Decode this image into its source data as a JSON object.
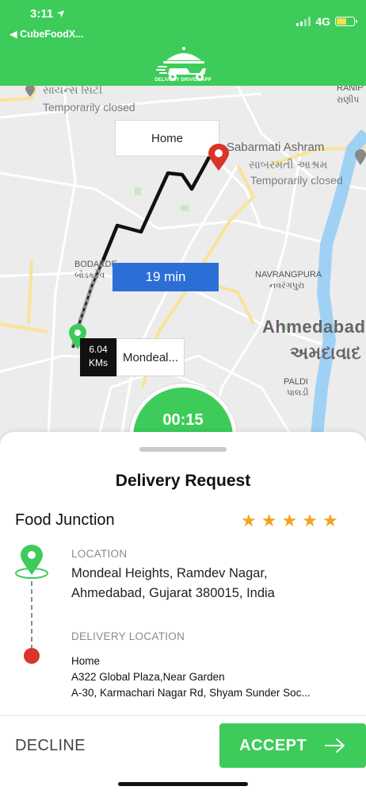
{
  "status_bar": {
    "time": "3:11",
    "back_app": "CubeFoodX...",
    "network": "4G"
  },
  "header": {
    "logo_caption": "DELIVERY DRIVER APP",
    "background_color": "#3dcc5a"
  },
  "map": {
    "labels": {
      "top_left_place": "સાયન્સ સિટી",
      "top_left_status": "Temporarily closed",
      "ashram_en": "Sabarmati Ashram",
      "ashram_gu": "સાબરમતી આશ્રમ",
      "ashram_status": "Temporarily closed",
      "ranip_en": "RANIP",
      "ranip_gu": "રાણીપ",
      "bodakdev_en": "BODAKDE",
      "bodakdev_gu": "બોડકદેવ",
      "navrangpura_en": "NAVRANGPURA",
      "navrangpura_gu": "નવરંગપુરા",
      "ahmedabad_en": "Ahmedabad",
      "ahmedabad_gu": "અમદાવાદ",
      "paldi_en": "PALDI",
      "paldi_gu": "પાલડી"
    },
    "destination_callout": "Home",
    "eta": "19 min",
    "distance_value": "6.04",
    "distance_unit": "KMs",
    "origin_callout": "Mondeal..."
  },
  "timer": "00:15",
  "request": {
    "title": "Delivery Request",
    "restaurant": "Food Junction",
    "rating": 5,
    "stars": [
      "★",
      "★",
      "★",
      "★",
      "★"
    ],
    "pickup_label": "LOCATION",
    "pickup_address": "Mondeal Heights, Ramdev Nagar, Ahmedabad, Gujarat 380015, India",
    "delivery_label": "DELIVERY LOCATION",
    "delivery_name": "Home",
    "delivery_line1": "A322 Global Plaza,Near Garden",
    "delivery_line2": "A-30,  Karmachari Nagar Rd,  Shyam Sunder Soc..."
  },
  "actions": {
    "decline": "DECLINE",
    "accept": "ACCEPT"
  },
  "colors": {
    "accent_green": "#3dcc5a",
    "eta_blue": "#2b6fd6",
    "star": "#f4a31d",
    "drop_red": "#d9352b"
  }
}
